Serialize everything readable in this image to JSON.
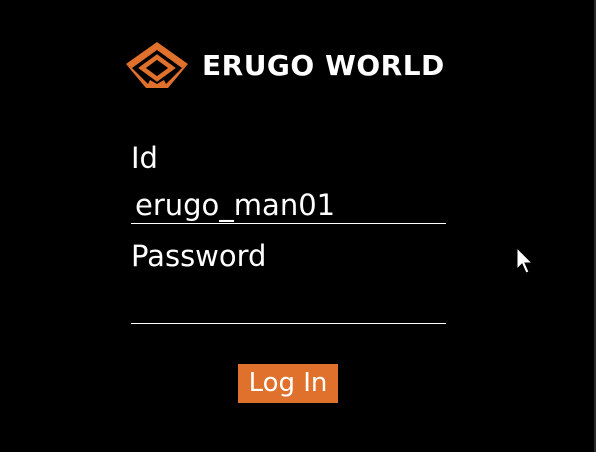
{
  "brand": {
    "name": "ERUGO WORLD",
    "accent_color": "#e0712c",
    "logo_icon": "erugo-diamond-logo-icon"
  },
  "login_form": {
    "id_label": "Id",
    "id_value": "erugo_man01",
    "password_label": "Password",
    "password_value": "",
    "submit_label": "Log In"
  },
  "pointer": {
    "icon": "mouse-pointer-icon"
  }
}
